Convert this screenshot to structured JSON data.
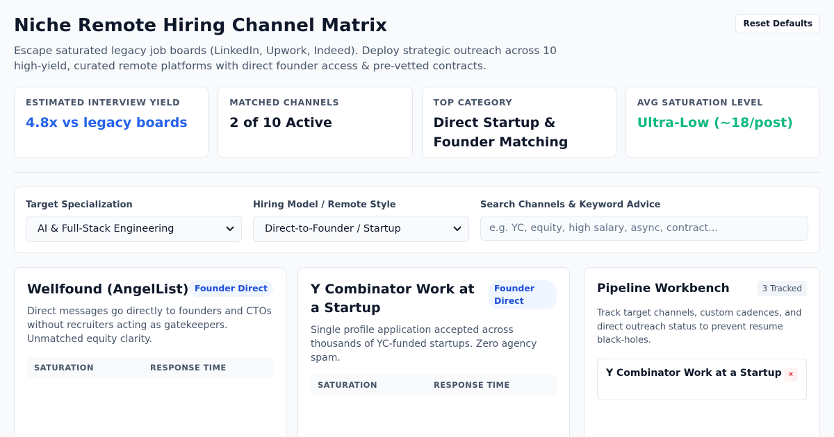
{
  "header": {
    "title": "Niche Remote Hiring Channel Matrix",
    "subtitle": "Escape saturated legacy job boards (LinkedIn, Upwork, Indeed). Deploy strategic outreach across 10 high-yield, curated remote platforms with direct founder access & pre-vetted contracts.",
    "reset_label": "Reset Defaults"
  },
  "stats": [
    {
      "label": "ESTIMATED INTERVIEW YIELD",
      "value": "4.8x vs legacy boards",
      "color": "#2563eb"
    },
    {
      "label": "MATCHED CHANNELS",
      "value": "2 of 10 Active",
      "color": "#0f172a"
    },
    {
      "label": "TOP CATEGORY",
      "value": "Direct Startup & Founder Matching",
      "color": "#0f172a"
    },
    {
      "label": "AVG SATURATION LEVEL",
      "value": "Ultra-Low (~18/post)",
      "color": "#10b981"
    }
  ],
  "filters": {
    "specialization_label": "Target Specialization",
    "specialization_value": "AI & Full-Stack Engineering",
    "model_label": "Hiring Model / Remote Style",
    "model_value": "Direct-to-Founder / Startup",
    "search_label": "Search Channels & Keyword Advice",
    "search_placeholder": "e.g. YC, equity, high salary, async, contract..."
  },
  "channels": [
    {
      "name": "Wellfound (AngelList)",
      "badge": "Founder Direct",
      "description": "Direct messages go directly to founders and CTOs without recruiters acting as gatekeepers. Unmatched equity clarity.",
      "saturation_label": "SATURATION",
      "response_label": "RESPONSE TIME"
    },
    {
      "name": "Y Combinator Work at a Startup",
      "badge": "Founder Direct",
      "description": "Single profile application accepted across thousands of YC-funded startups. Zero agency spam.",
      "saturation_label": "SATURATION",
      "response_label": "RESPONSE TIME"
    }
  ],
  "pipeline": {
    "title": "Pipeline Workbench",
    "tracked": "3 Tracked",
    "description": "Track target channels, custom cadences, and direct outreach status to prevent resume black-holes.",
    "items": [
      {
        "name": "Y Combinator Work at a Startup",
        "remove": "×"
      }
    ]
  },
  "colors": {
    "accent_blue": "#2563eb",
    "accent_green": "#10b981",
    "badge_bg": "#eff6ff",
    "border": "#e2e8f0"
  }
}
